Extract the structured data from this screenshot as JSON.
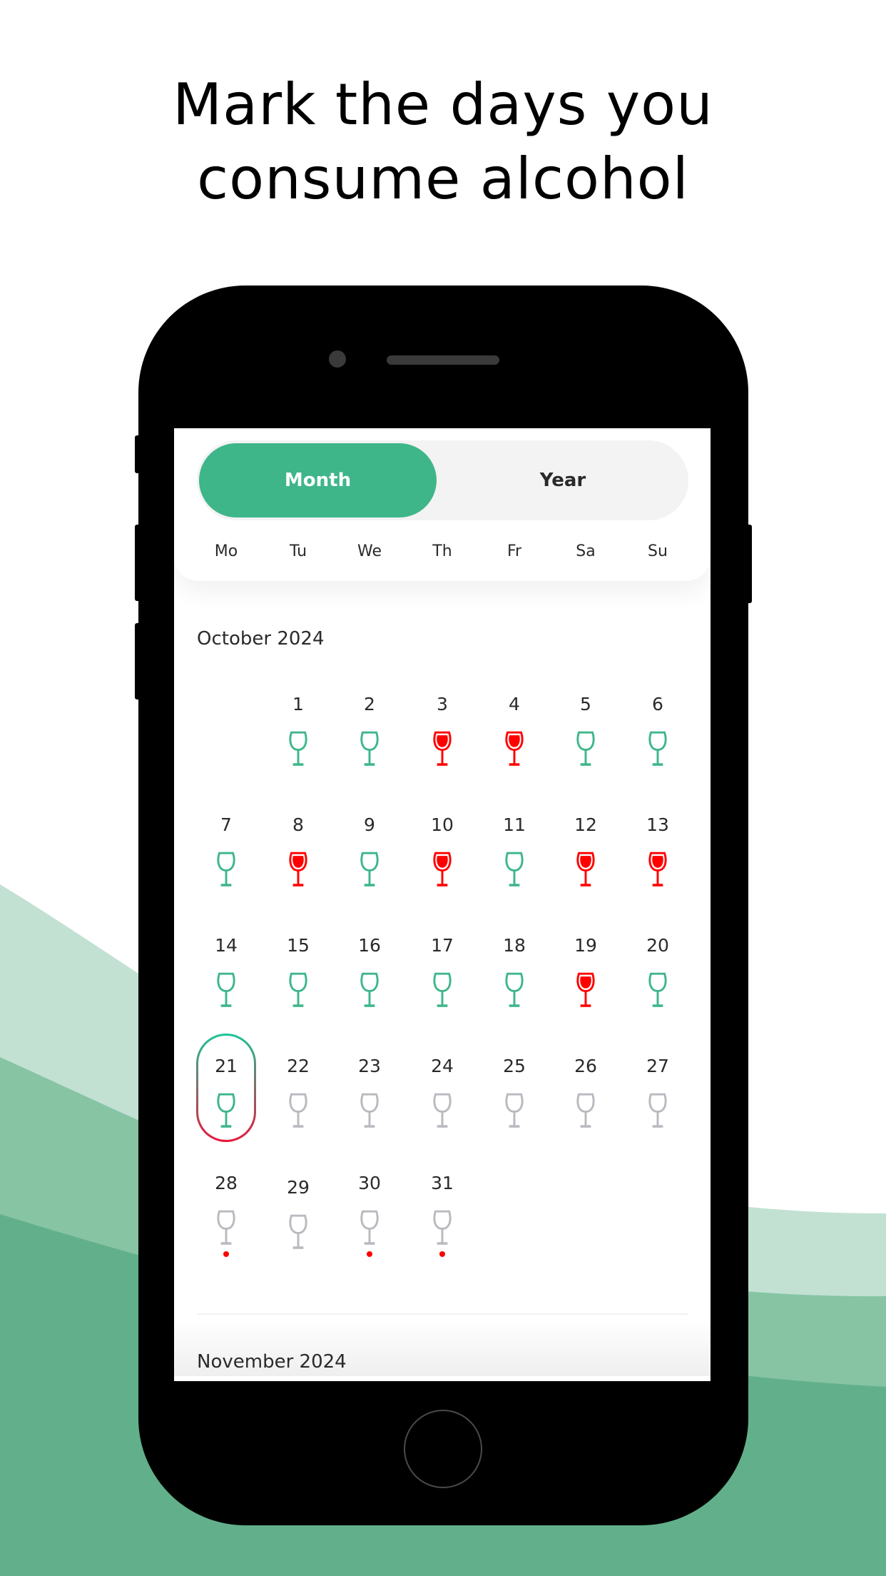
{
  "headline": {
    "line1": "Mark the days you",
    "line2": "consume alcohol"
  },
  "colors": {
    "accent": "#3eb68a",
    "drink": "#ff0000",
    "sober": "#3eb68a",
    "future": "#b9b9c0",
    "wave_light": "#c2e1d3",
    "wave_mid": "#86c4a4",
    "wave_dark": "#62b08b"
  },
  "toggle": {
    "month_label": "Month",
    "year_label": "Year",
    "selected": "Month"
  },
  "weekdays": [
    "Mo",
    "Tu",
    "We",
    "Th",
    "Fr",
    "Sa",
    "Su"
  ],
  "months": [
    {
      "title": "October 2024",
      "start_weekday": 1,
      "today": 21,
      "days": [
        {
          "d": "1",
          "s": "sober"
        },
        {
          "d": "2",
          "s": "sober"
        },
        {
          "d": "3",
          "s": "drink"
        },
        {
          "d": "4",
          "s": "drink"
        },
        {
          "d": "5",
          "s": "sober"
        },
        {
          "d": "6",
          "s": "sober"
        },
        {
          "d": "7",
          "s": "sober"
        },
        {
          "d": "8",
          "s": "drink"
        },
        {
          "d": "9",
          "s": "sober"
        },
        {
          "d": "10",
          "s": "drink"
        },
        {
          "d": "11",
          "s": "sober"
        },
        {
          "d": "12",
          "s": "drink"
        },
        {
          "d": "13",
          "s": "drink"
        },
        {
          "d": "14",
          "s": "sober"
        },
        {
          "d": "15",
          "s": "sober"
        },
        {
          "d": "16",
          "s": "sober"
        },
        {
          "d": "17",
          "s": "sober"
        },
        {
          "d": "18",
          "s": "sober"
        },
        {
          "d": "19",
          "s": "drink"
        },
        {
          "d": "20",
          "s": "sober"
        },
        {
          "d": "21",
          "s": "sober"
        },
        {
          "d": "22",
          "s": "future"
        },
        {
          "d": "23",
          "s": "future"
        },
        {
          "d": "24",
          "s": "future"
        },
        {
          "d": "25",
          "s": "future"
        },
        {
          "d": "26",
          "s": "future"
        },
        {
          "d": "27",
          "s": "future"
        },
        {
          "d": "28",
          "s": "future",
          "dot": true
        },
        {
          "d": "29",
          "s": "future"
        },
        {
          "d": "30",
          "s": "future",
          "dot": true
        },
        {
          "d": "31",
          "s": "future",
          "dot": true
        }
      ]
    },
    {
      "title": "November 2024"
    }
  ]
}
